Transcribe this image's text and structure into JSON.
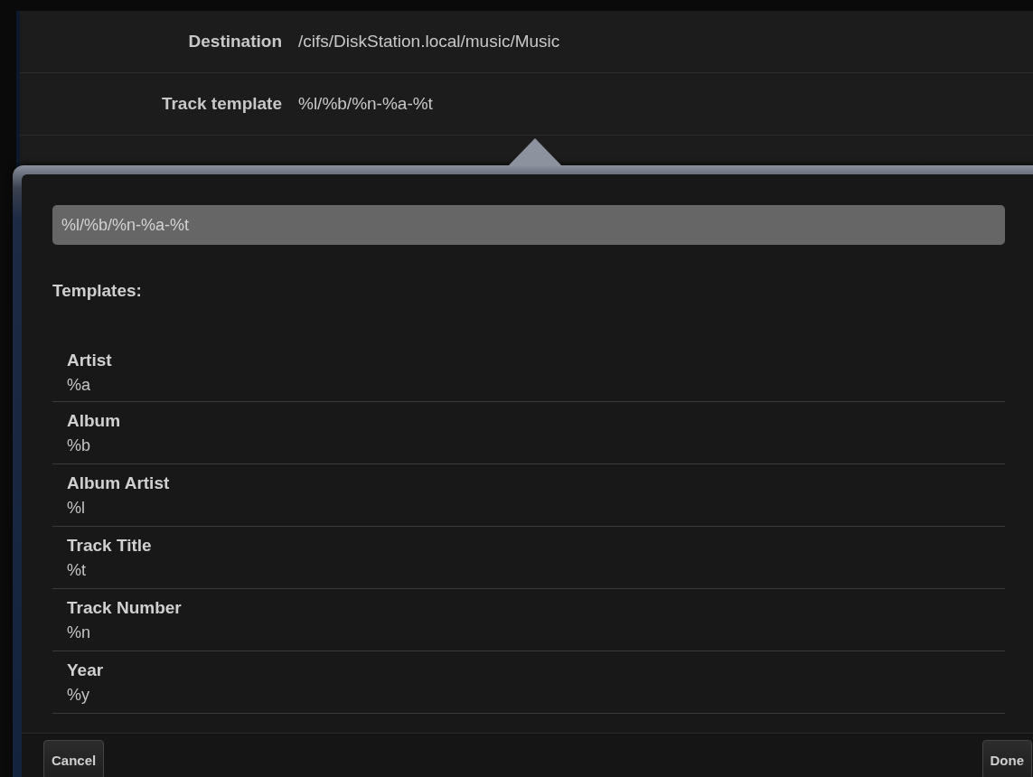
{
  "settings": [
    {
      "label": "Destination",
      "value": "/cifs/DiskStation.local/music/Music"
    },
    {
      "label": "Track template",
      "value": "%l/%b/%n-%a-%t"
    }
  ],
  "popover": {
    "field": {
      "value": "%l/%b/%n-%a-%t"
    },
    "heading": "Templates:",
    "templates": [
      {
        "name": "Artist",
        "code": "%a"
      },
      {
        "name": "Album",
        "code": "%b"
      },
      {
        "name": "Album Artist",
        "code": "%l"
      },
      {
        "name": "Track Title",
        "code": "%t"
      },
      {
        "name": "Track Number",
        "code": "%n"
      },
      {
        "name": "Year",
        "code": "%y"
      }
    ],
    "buttons": {
      "cancel": "Cancel",
      "done": "Done"
    }
  }
}
